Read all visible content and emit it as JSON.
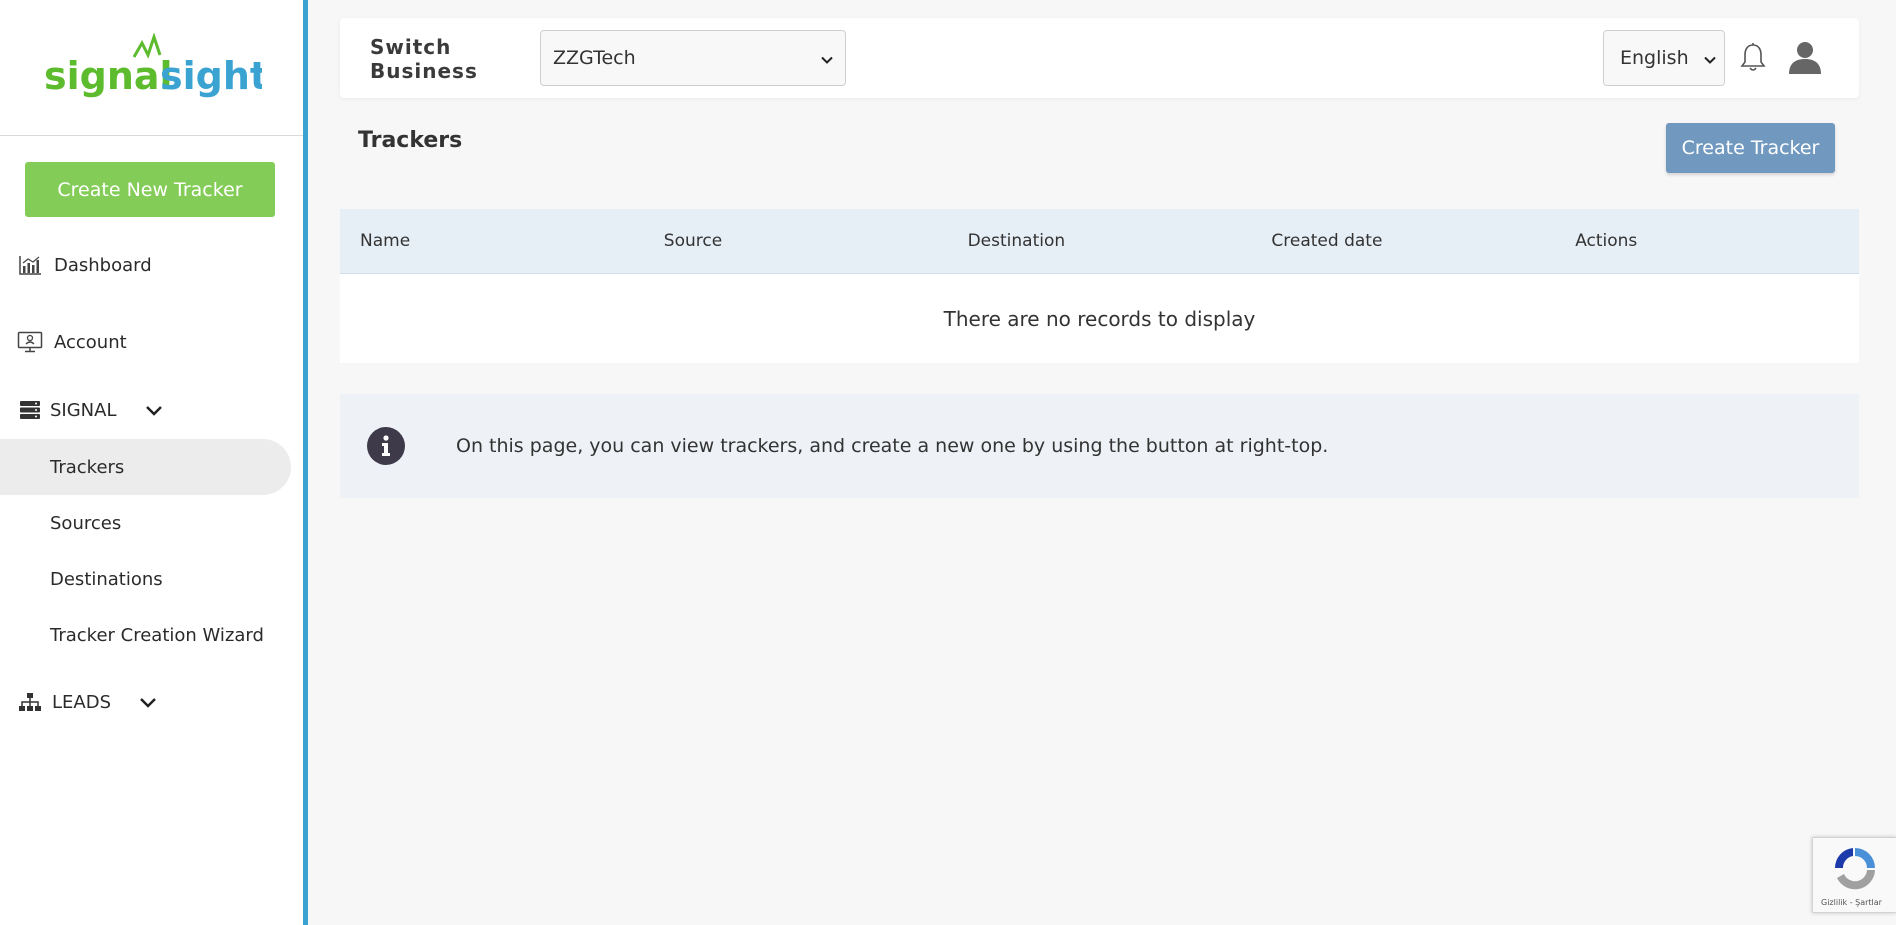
{
  "brand": {
    "name_part1": "signal",
    "name_part2": "sight",
    "color_green": "#5dbb2e",
    "color_blue": "#3aa3d1"
  },
  "sidebar": {
    "create_button": "Create New Tracker",
    "items": [
      {
        "label": "Dashboard",
        "icon": "chart-icon"
      },
      {
        "label": "Account",
        "icon": "monitor-icon"
      }
    ],
    "signal_section": {
      "label": "SIGNAL",
      "icon": "server-icon",
      "sub_items": [
        "Trackers",
        "Sources",
        "Destinations",
        "Tracker Creation Wizard"
      ],
      "active": "Trackers"
    },
    "leads_section": {
      "label": "LEADS",
      "icon": "sitemap-icon"
    }
  },
  "topbar": {
    "switch_label_line1": "Switch",
    "switch_label_line2": "Business",
    "business_selected": "ZZGTech",
    "language_selected": "English"
  },
  "page": {
    "title": "Trackers",
    "create_button": "Create Tracker",
    "table": {
      "columns": [
        "Name",
        "Source",
        "Destination",
        "Created date",
        "Actions"
      ],
      "empty_message": "There are no records to display"
    },
    "info_text": "On this page, you can view trackers, and create a new one by using the button at right-top."
  },
  "recaptcha": {
    "text": "Gizlilik - Şartlar"
  }
}
